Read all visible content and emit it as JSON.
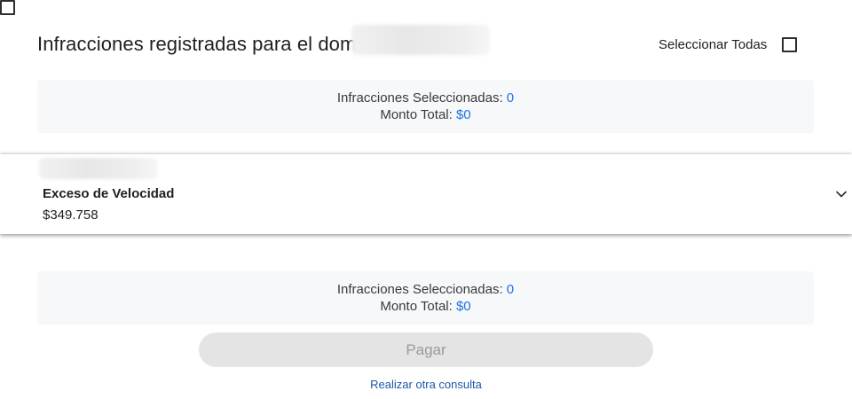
{
  "header": {
    "title": "Infracciones registradas para el dom",
    "select_all_label": "Seleccionar Todas"
  },
  "summary_top": {
    "selected_label": "Infracciones Seleccionadas:",
    "selected_value": "0",
    "total_label": "Monto Total:",
    "total_value": "$0"
  },
  "infraction": {
    "name": "Exceso de Velocidad",
    "amount": "$349.758"
  },
  "summary_bottom": {
    "selected_label": "Infracciones Seleccionadas:",
    "selected_value": "0",
    "total_label": "Monto Total:",
    "total_value": "$0"
  },
  "actions": {
    "pay_label": "Pagar",
    "new_query_label": "Realizar otra consulta"
  },
  "colors": {
    "accent": "#1a73e8",
    "link": "#1a57a8",
    "disabled_button": "#e4e4e4"
  },
  "icons": {
    "expand": "chevron-down-icon"
  }
}
